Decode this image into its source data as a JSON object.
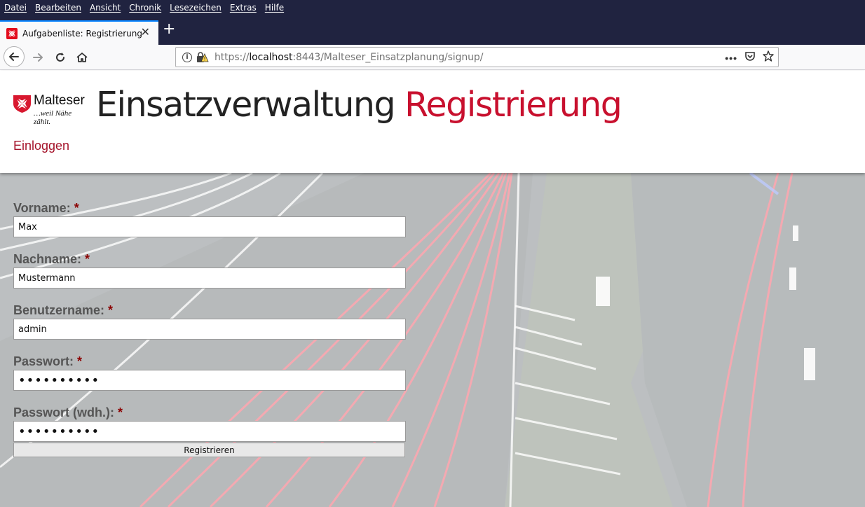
{
  "browser": {
    "menu": [
      "Datei",
      "Bearbeiten",
      "Ansicht",
      "Chronik",
      "Lesezeichen",
      "Extras",
      "Hilfe"
    ],
    "tab": {
      "title": "Aufgabenliste: Registrierung"
    },
    "url": {
      "protocol": "https://",
      "host": "localhost",
      "rest": ":8443/Malteser_Einsatzplanung/signup/"
    },
    "url_more": "•••"
  },
  "header": {
    "logo_brand": "Malteser",
    "logo_tagline": "…weil Nähe zählt.",
    "title_main": "Einsatzverwaltung",
    "title_accent": "Registrierung",
    "login_link": "Einloggen"
  },
  "form": {
    "required_marker": "*",
    "fields": [
      {
        "label": "Vorname:",
        "value": "Max",
        "type": "text"
      },
      {
        "label": "Nachname:",
        "value": "Mustermann",
        "type": "text"
      },
      {
        "label": "Benutzername:",
        "value": "admin",
        "type": "text"
      },
      {
        "label": "Passwort:",
        "value": "••••••••••",
        "type": "password"
      },
      {
        "label": "Passwort (wdh.):",
        "value": "••••••••••",
        "type": "password"
      }
    ],
    "submit_label": "Registrieren"
  },
  "colors": {
    "accent": "#c8102e",
    "browser_dark": "#202340",
    "label_gray": "#555555"
  }
}
